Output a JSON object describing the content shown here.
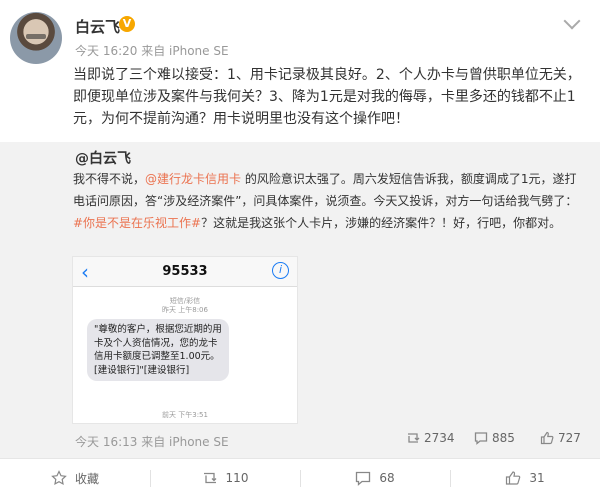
{
  "post": {
    "author": "白云飞",
    "vip_badge": "V",
    "meta": "今天 16:20 来自 iPhone SE",
    "text": "当即说了三个难以接受：1、用卡记录极其良好。2、个人办卡与曾供职单位无关，即便现单位涉及案件与我何关？3、降为1元是对我的侮辱，卡里多还的钱都不止1元，为何不提前沟通？用卡说明里也没有这个操作吧！"
  },
  "repost": {
    "author": "@白云飞",
    "text_before_mention": "我不得不说，",
    "mention": "@建行龙卡信用卡",
    "text_middle": " 的风险意识太强了。周六发短信告诉我，额度调成了1元，遂打电话问原因，答“涉及经济案件”，问具体案件，说须查。今天又投诉，对方一句话给我气劈了：",
    "hashtag": "#你是不是在乐视工作#",
    "text_after": "？这就是我这张个人卡片，涉嫌的经济案件？！好，行吧，你都对。",
    "screenshot": {
      "sender": "95533",
      "label_line1": "短信/彩信",
      "label_line2": "昨天 上午8:06",
      "message": "\"尊敬的客户，根据您近期的用卡及个人资信情况，您的龙卡信用卡额度已调整至1.00元。[建设银行]\"[建设银行]",
      "time": "前天 下午3:51"
    },
    "meta": "今天 16:13 来自 iPhone SE",
    "stats": {
      "reposts": "2734",
      "comments": "885",
      "likes": "727"
    }
  },
  "actions": {
    "favorite": "收藏",
    "repost": "110",
    "comment": "68",
    "like": "31"
  },
  "icons": {
    "back": "back-chevron-icon",
    "info": "info-icon",
    "repost": "repost-icon",
    "comment": "comment-icon",
    "like": "thumbs-up-icon",
    "favorite": "star-icon",
    "more": "chevron-down-icon"
  },
  "colors": {
    "link": "#eb7350",
    "vip": "#f7a700",
    "ios_blue": "#1b7cf4"
  }
}
